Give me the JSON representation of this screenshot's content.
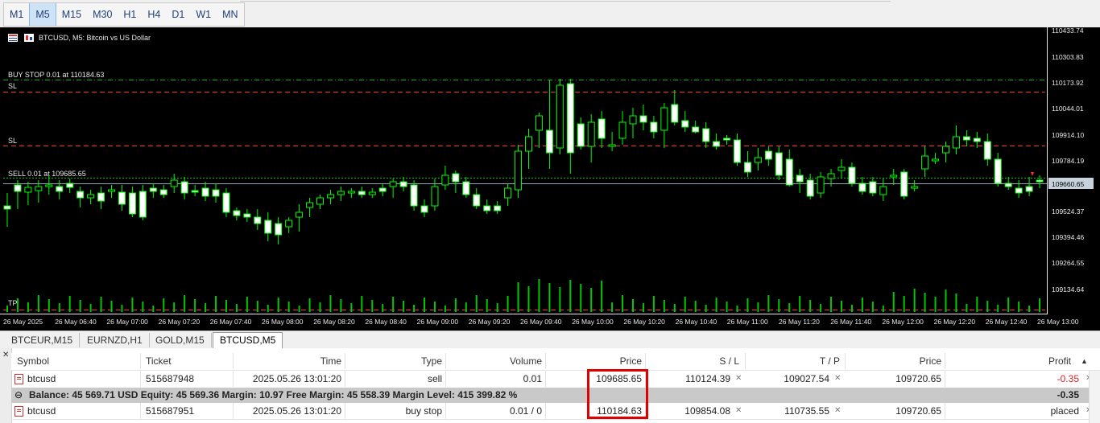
{
  "toolbar": {
    "timeframes": [
      "M1",
      "M5",
      "M15",
      "M30",
      "H1",
      "H4",
      "D1",
      "W1",
      "MN"
    ],
    "active": "M5"
  },
  "chart": {
    "title": "BTCUSD, M5:  Bitcoin vs US Dollar",
    "price_labels": [
      "110433.74",
      "110303.83",
      "110173.92",
      "110044.01",
      "109914.10",
      "109784.19",
      "109660.65",
      "109524.37",
      "109394.46",
      "109264.55",
      "109134.64"
    ],
    "current_price": "109660.65",
    "time_labels": [
      "26 May 2025",
      "26 May 06:40",
      "26 May 07:00",
      "26 May 07:20",
      "26 May 07:40",
      "26 May 08:00",
      "26 May 08:20",
      "26 May 08:40",
      "26 May 09:00",
      "26 May 09:20",
      "26 May 09:40",
      "26 May 10:00",
      "26 May 10:20",
      "26 May 10:40",
      "26 May 11:00",
      "26 May 11:20",
      "26 May 11:40",
      "26 May 12:00",
      "26 May 12:20",
      "26 May 12:40",
      "26 May 13:00"
    ],
    "line_labels": {
      "buy_stop": "BUY STOP 0.01 at 110184.63",
      "sl1": "SL",
      "sl2": "SL",
      "sell": "SELL 0.01 at 109685.65",
      "tp": "TP"
    },
    "colors": {
      "background": "#000000",
      "bull": "#000000",
      "bear": "#ffffff",
      "wick": "#00ff00",
      "sl": "#ff3030",
      "tp": "#ff3030",
      "buy_stop": "#00b400",
      "sell": "#00b400",
      "bid": "#8fa8b8"
    }
  },
  "chart_tabs": [
    "BTCEUR,M15",
    "EURNZD,H1",
    "GOLD,M15",
    "BTCUSD,M5"
  ],
  "active_chart_tab": "BTCUSD,M5",
  "table": {
    "headers": {
      "symbol": "Symbol",
      "ticket": "Ticket",
      "time": "Time",
      "type": "Type",
      "volume": "Volume",
      "price": "Price",
      "sl": "S / L",
      "tp": "T / P",
      "cur_price": "Price",
      "profit": "Profit"
    },
    "rows": [
      {
        "symbol": "btcusd",
        "ticket": "515687948",
        "time": "2025.05.26 13:01:20",
        "type": "sell",
        "volume": "0.01",
        "price": "109685.65",
        "sl": "110124.39",
        "tp": "109027.54",
        "cur_price": "109720.65",
        "profit": "-0.35"
      },
      {
        "symbol": "btcusd",
        "ticket": "515687951",
        "time": "2025.05.26 13:01:20",
        "type": "buy stop",
        "volume": "0.01 / 0",
        "price": "110184.63",
        "sl": "109854.08",
        "tp": "110735.55",
        "cur_price": "109720.65",
        "profit": "placed"
      }
    ],
    "balance_line": "Balance: 45 569.71 USD  Equity: 45 569.36  Margin: 10.97  Free Margin: 45 558.39  Margin Level: 415 399.82 %",
    "balance_profit": "-0.35"
  }
}
